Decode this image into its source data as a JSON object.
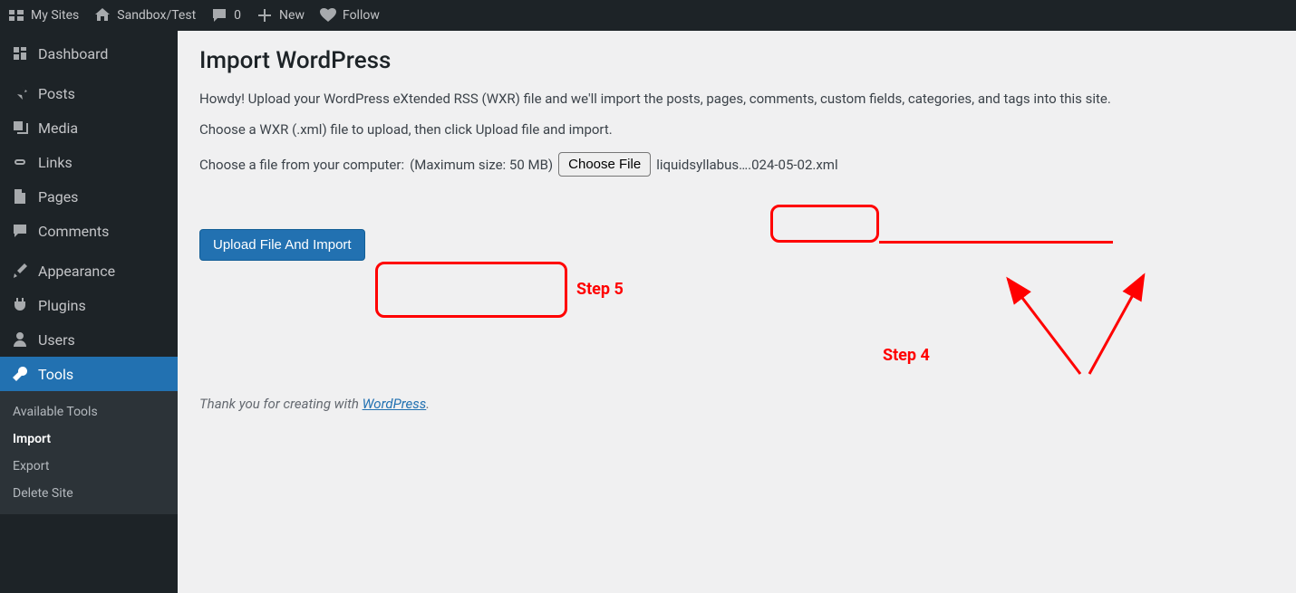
{
  "adminbar": {
    "my_sites": "My Sites",
    "site_name": "Sandbox/Test",
    "comments_count": "0",
    "new_label": "New",
    "follow_label": "Follow"
  },
  "sidebar": {
    "dashboard": "Dashboard",
    "posts": "Posts",
    "media": "Media",
    "links": "Links",
    "pages": "Pages",
    "comments": "Comments",
    "appearance": "Appearance",
    "plugins": "Plugins",
    "users": "Users",
    "tools": "Tools",
    "submenu": {
      "available": "Available Tools",
      "import": "Import",
      "export": "Export",
      "delete_site": "Delete Site"
    }
  },
  "page": {
    "title": "Import WordPress",
    "intro": "Howdy! Upload your WordPress eXtended RSS (WXR) file and we'll import the posts, pages, comments, custom fields, categories, and tags into this site.",
    "instruction": "Choose a WXR (.xml) file to upload, then click Upload file and import.",
    "choose_label": "Choose a file from your computer:",
    "max_size": "(Maximum size: 50 MB)",
    "choose_button": "Choose File",
    "filename": "liquidsyllabus….024-05-02.xml",
    "upload_button": "Upload File And Import",
    "footer_prefix": "Thank you for creating with ",
    "footer_link": "WordPress",
    "footer_suffix": "."
  },
  "annotations": {
    "step4": "Step 4",
    "step5": "Step 5"
  }
}
